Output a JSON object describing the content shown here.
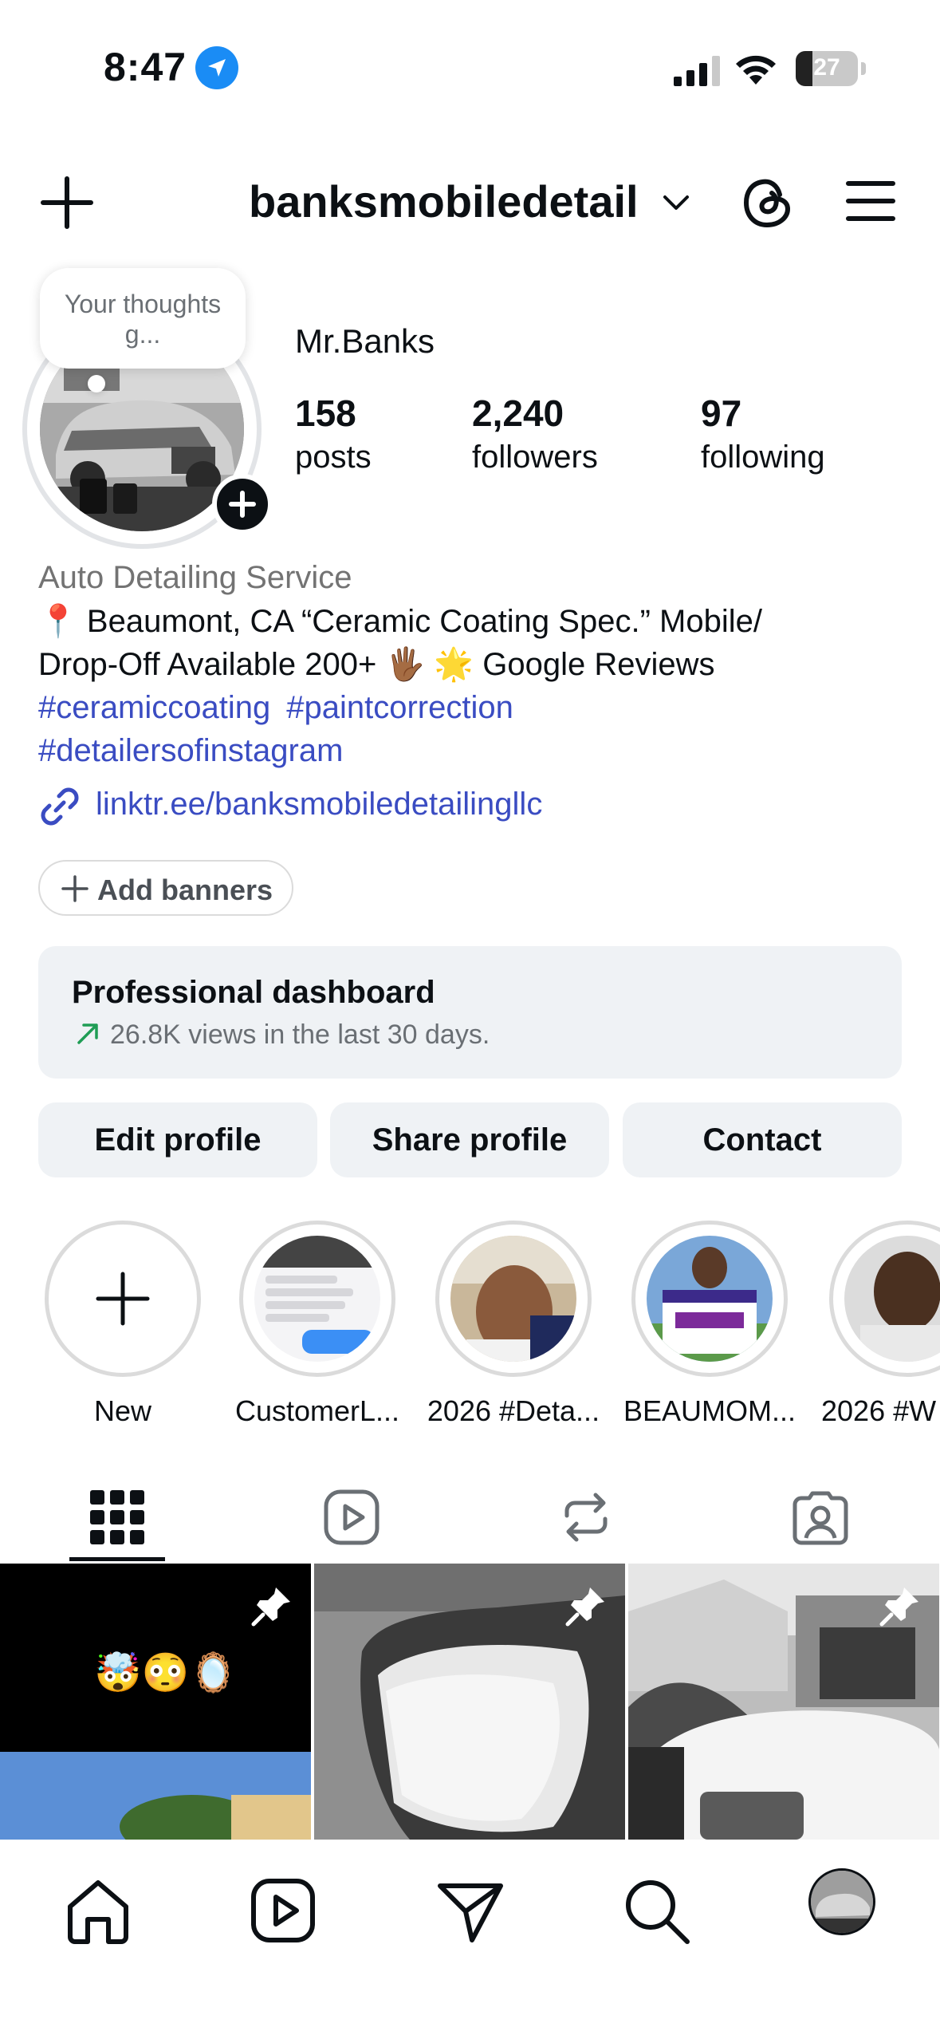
{
  "status_bar": {
    "time": "8:47",
    "battery": "27",
    "battery_level": 0.27
  },
  "header": {
    "username": "banksmobiledetail"
  },
  "profile": {
    "note_bubble": "Your thoughts g...",
    "display_name": "Mr.Banks",
    "stats": [
      {
        "value": "158",
        "label": "posts"
      },
      {
        "value": "2,240",
        "label": "followers"
      },
      {
        "value": "97",
        "label": "following"
      }
    ],
    "category": "Auto Detailing Service",
    "bio_line1": "📍 Beaumont, CA “Ceramic Coating Spec.” Mobile/",
    "bio_line2": "Drop-Off Available 200+ 🖐🏾 🌟 Google Reviews",
    "hashtags": [
      "#ceramiccoating",
      "#paintcorrection",
      "#detailersofinstagram"
    ],
    "link": "linktr.ee/banksmobiledetailingllc"
  },
  "add_banners_label": "Add banners",
  "dashboard": {
    "title": "Professional dashboard",
    "subtitle": "26.8K views in the last 30 days."
  },
  "buttons": {
    "edit": "Edit profile",
    "share": "Share profile",
    "contact": "Contact"
  },
  "highlights": [
    {
      "label": "New"
    },
    {
      "label": "CustomerL..."
    },
    {
      "label": "2026 #Deta..."
    },
    {
      "label": "BEAUMOM..."
    },
    {
      "label": "2026 #W"
    }
  ],
  "grid_posts": [
    {
      "emojis": "🤯😳🪞"
    },
    {},
    {}
  ],
  "colors": {
    "text": "#0c1014",
    "link": "#3a4cc2",
    "secondary": "#737373",
    "button_bg": "#eff2f5",
    "location_blue": "#1a8cf5",
    "trend_green": "#1f9d55"
  }
}
